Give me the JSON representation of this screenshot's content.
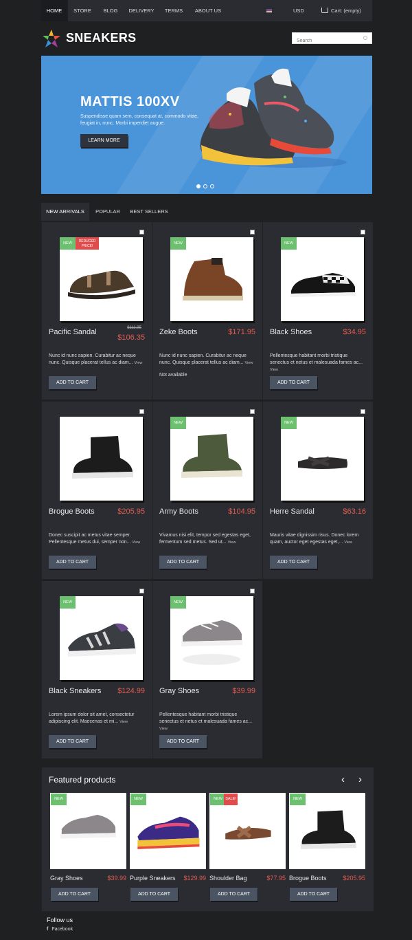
{
  "nav": {
    "items": [
      "HOME",
      "STORE",
      "BLOG",
      "DELIVERY",
      "TERMS",
      "ABOUT US"
    ],
    "currency": "USD",
    "cart": "Cart: (empty)"
  },
  "logo": {
    "text": "SNEAKERS"
  },
  "search": {
    "placeholder": "Search"
  },
  "banner": {
    "title": "MATTIS 100XV",
    "text": "Suspendisse quam sem, consequat at, commodo vitae, feugiat in, nunc. Morbi imperdiet augue.",
    "button": "LEARN MORE"
  },
  "tabs": [
    "NEW ARRIVALS",
    "POPULAR",
    "BEST SELLERS"
  ],
  "badges": {
    "new": "NEW",
    "reduced": "REDUCED PRICE!",
    "sale": "SALE!"
  },
  "products": [
    {
      "name": "Pacific Sandal",
      "price": "$106.35",
      "old_price": "$111.95",
      "desc": "Nunc id nunc sapien. Curabitur ac neque nunc. Quisque placerat tellus ac diam...",
      "view": "View",
      "button": "ADD TO CART"
    },
    {
      "name": "Zeke Boots",
      "price": "$171.95",
      "desc": "Nunc id nunc sapien. Curabitur ac neque nunc. Quisque placerat tellus ac diam...",
      "view": "View",
      "availability": "Not available"
    },
    {
      "name": "Black Shoes",
      "price": "$34.95",
      "desc": "Pellentesque habitant morbi tristique senectus et netus et malesuada fames ac...",
      "view": "View",
      "button": "ADD TO CART"
    },
    {
      "name": "Brogue Boots",
      "price": "$205.95",
      "desc": "Donec suscipit ac metus vitae semper. Pellentesque metus dui, semper non...",
      "view": "View",
      "button": "ADD TO CART"
    },
    {
      "name": "Army Boots",
      "price": "$104.95",
      "desc": "Vivamus nisi elit, tempor sed egestas eget, fermentum sed metus. Sed ut...",
      "view": "View",
      "button": "ADD TO CART"
    },
    {
      "name": "Herre Sandal",
      "price": "$63.16",
      "desc": "Mauris vitae dignissim risus. Donec lorem quam, auctor eget egestas eget,...",
      "view": "View",
      "button": "ADD TO CART"
    },
    {
      "name": "Black Sneakers",
      "price": "$124.99",
      "desc": "Lorem ipsum dolor sit amet, consectetur adipiscing elit. Maecenas et mi...",
      "view": "View",
      "button": "ADD TO CART"
    },
    {
      "name": "Gray Shoes",
      "price": "$39.99",
      "desc": "Pellentesque habitant morbi tristique senectus et netus et malesuada fames ac...",
      "view": "View",
      "button": "ADD TO CART"
    }
  ],
  "featured": {
    "title": "Featured products",
    "prev": "‹",
    "next": "›",
    "items": [
      {
        "name": "Gray Shoes",
        "price": "$39.99",
        "button": "ADD TO CART"
      },
      {
        "name": "Purple Sneakers",
        "price": "$129.99",
        "button": "ADD TO CART"
      },
      {
        "name": "Shoulder Bag",
        "price": "$77.95",
        "button": "ADD TO CART"
      },
      {
        "name": "Brogue Boots",
        "price": "$205.95",
        "button": "ADD TO CART"
      }
    ]
  },
  "follow": {
    "title": "Follow us",
    "facebook": "Facebook"
  },
  "colors": {
    "accent_price": "#e25b50",
    "badge_new": "#6cc06f",
    "badge_sale": "#e04b4b",
    "banner": "#4a94da",
    "background": "#1f2022",
    "panel": "#2a2c31",
    "button": "#4b5462"
  }
}
